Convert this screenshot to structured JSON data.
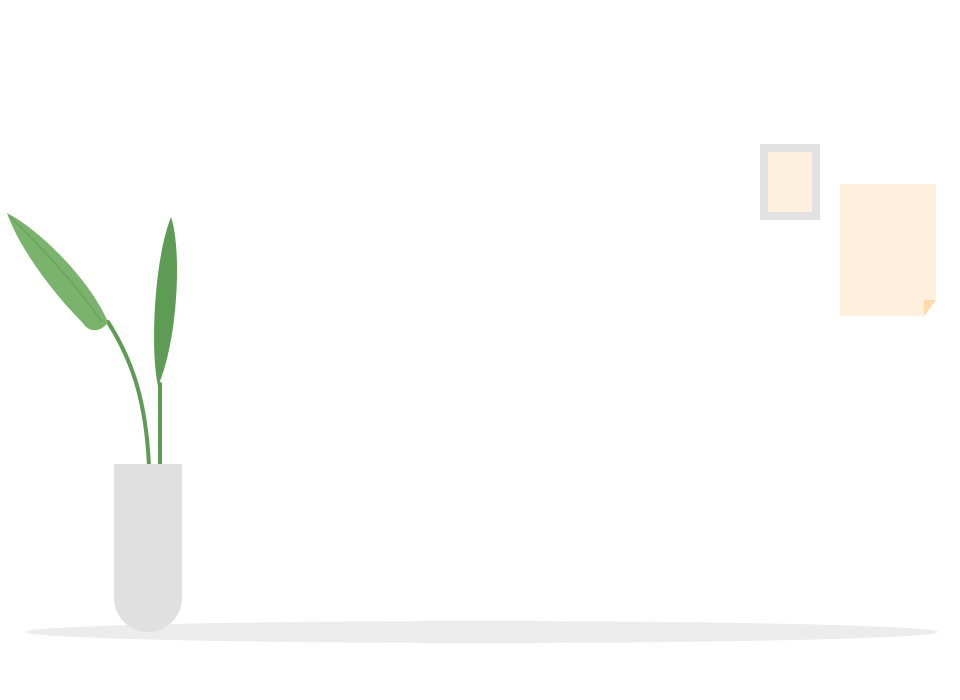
{
  "scene": {
    "type": "empty-state-illustration",
    "objects": [
      "potted-plant",
      "floor-shadow",
      "wall-picture-frame",
      "wall-note"
    ]
  },
  "colors": {
    "background": "#ffffff",
    "floor_shadow": "#ececec",
    "vase": "#e0e0e0",
    "leaf_light": "#7ab36c",
    "leaf_dark": "#5e9b55",
    "stem": "#5e9b55",
    "frame_border": "#e2e2e2",
    "frame_fill": "#fdf0de",
    "note_fill": "#fff0dd",
    "note_fold": "#ffd9a6"
  }
}
